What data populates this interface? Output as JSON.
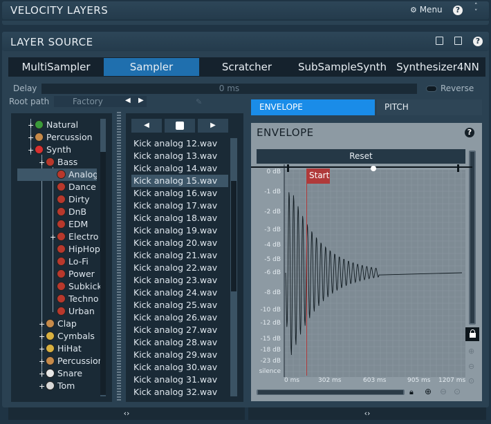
{
  "top_header": {
    "title": "VELOCITY LAYERS",
    "menu_label": "Menu"
  },
  "layer_source": {
    "title": "LAYER SOURCE",
    "tabs": [
      {
        "label": "MultiSampler",
        "active": false
      },
      {
        "label": "Sampler",
        "active": true
      },
      {
        "label": "Scratcher",
        "active": false
      },
      {
        "label": "SubSampleSynth",
        "active": false
      },
      {
        "label": "Synthesizer4NN",
        "active": false
      }
    ],
    "delay_label": "Delay",
    "delay_value": "0 ms",
    "reverse_label": "Reverse",
    "root_path_label": "Root path",
    "root_path_value": "Factory"
  },
  "tree": [
    {
      "label": "Natural",
      "icon": "drum-icon"
    },
    {
      "label": "Percussion",
      "icon": "bongo-icon"
    },
    {
      "label": "Synth",
      "icon": "synth-drum-icon"
    },
    {
      "label": "Bass",
      "icon": "speaker-icon"
    },
    {
      "label": "Analog",
      "icon": "speaker-icon",
      "selected": true
    },
    {
      "label": "Dance",
      "icon": "speaker-icon"
    },
    {
      "label": "Dirty",
      "icon": "speaker-icon"
    },
    {
      "label": "DnB",
      "icon": "speaker-icon"
    },
    {
      "label": "EDM",
      "icon": "speaker-icon"
    },
    {
      "label": "Electro",
      "icon": "speaker-icon"
    },
    {
      "label": "HipHop",
      "icon": "speaker-icon"
    },
    {
      "label": "Lo-Fi",
      "icon": "speaker-icon"
    },
    {
      "label": "Power",
      "icon": "speaker-icon"
    },
    {
      "label": "Subkick",
      "icon": "speaker-icon"
    },
    {
      "label": "Techno",
      "icon": "speaker-icon"
    },
    {
      "label": "Urban",
      "icon": "speaker-icon"
    },
    {
      "label": "Clap",
      "icon": "clap-icon"
    },
    {
      "label": "Cymbals",
      "icon": "cymbal-icon"
    },
    {
      "label": "HiHat",
      "icon": "hihat-icon"
    },
    {
      "label": "Percussion",
      "icon": "bongo-icon"
    },
    {
      "label": "Snare",
      "icon": "snare-icon"
    },
    {
      "label": "Tom",
      "icon": "tom-icon"
    }
  ],
  "files": [
    "Kick analog 12.wav",
    "Kick analog 13.wav",
    "Kick analog 14.wav",
    "Kick analog 15.wav",
    "Kick analog 16.wav",
    "Kick analog 17.wav",
    "Kick analog 18.wav",
    "Kick analog 19.wav",
    "Kick analog 20.wav",
    "Kick analog 21.wav",
    "Kick analog 22.wav",
    "Kick analog 23.wav",
    "Kick analog 24.wav",
    "Kick analog 25.wav",
    "Kick analog 26.wav",
    "Kick analog 27.wav",
    "Kick analog 28.wav",
    "Kick analog 29.wav",
    "Kick analog 30.wav",
    "Kick analog 31.wav",
    "Kick analog 32.wav"
  ],
  "selected_file_index": 3,
  "envelope_tabs": [
    {
      "label": "ENVELOPE",
      "active": true
    },
    {
      "label": "PITCH",
      "active": false
    }
  ],
  "envelope": {
    "title": "ENVELOPE",
    "reset_label": "Reset",
    "start_label": "Start",
    "db_labels": [
      "0 dB",
      "-1 dB",
      "-2 dB",
      "-3 dB",
      "-4 dB",
      "-5 dB",
      "-6 dB",
      "-8 dB",
      "-10 dB",
      "-12 dB",
      "-15 dB",
      "-18 dB",
      "-23 dB",
      "silence"
    ],
    "time_labels": [
      "0 ms",
      "302 ms",
      "603 ms",
      "905 ms",
      "1207 ms"
    ]
  },
  "bottom": {
    "left_toggle": "‹›",
    "right_toggle": "‹›"
  },
  "colors": {
    "accent": "#1f6fae",
    "background": "#1f3444",
    "start_marker": "#b03a3a"
  }
}
